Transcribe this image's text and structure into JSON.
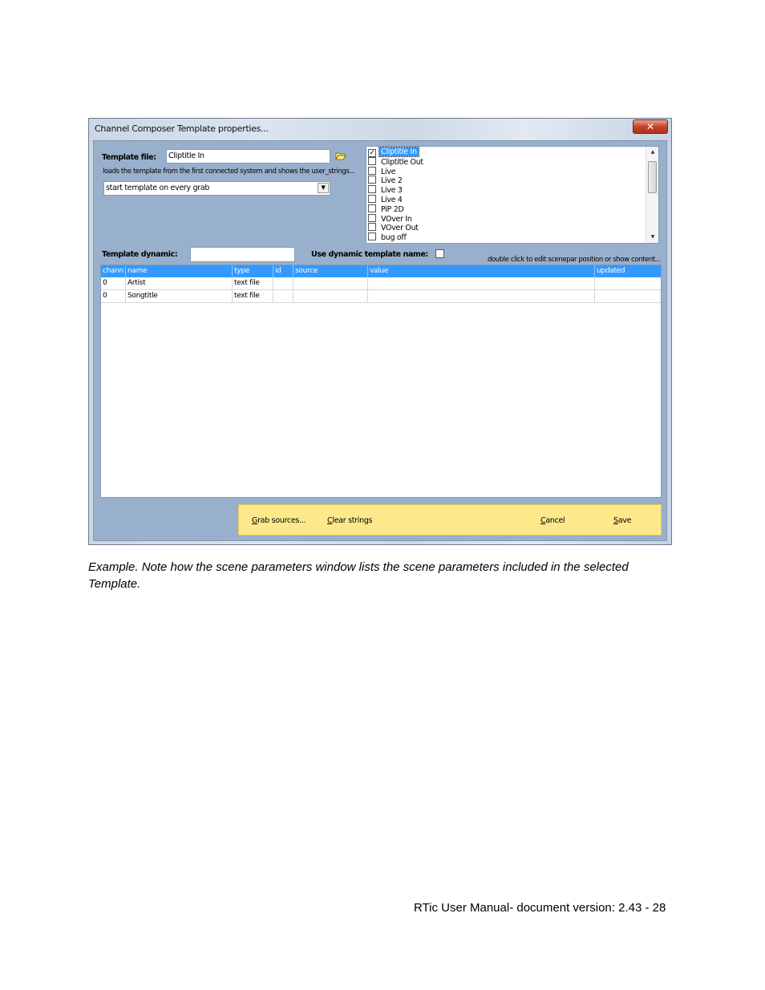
{
  "dialog": {
    "title": "Channel Composer Template properties...",
    "close_label": "✕",
    "template_file": {
      "label": "Template file:",
      "value": "Cliptitle In",
      "note": "loads the template from the first connected system and shows the user_strings...",
      "mode_selected": "start template on every grab"
    },
    "templates": [
      {
        "name": "Cliptitle In",
        "checked": true,
        "selected": true
      },
      {
        "name": "Cliptitle Out",
        "checked": false,
        "selected": false
      },
      {
        "name": "Live",
        "checked": false,
        "selected": false
      },
      {
        "name": "Live 2",
        "checked": false,
        "selected": false
      },
      {
        "name": "Live 3",
        "checked": false,
        "selected": false
      },
      {
        "name": "Live 4",
        "checked": false,
        "selected": false
      },
      {
        "name": "PiP 2D",
        "checked": false,
        "selected": false
      },
      {
        "name": "VOver In",
        "checked": false,
        "selected": false
      },
      {
        "name": "VOver Out",
        "checked": false,
        "selected": false
      },
      {
        "name": "bug off",
        "checked": false,
        "selected": false
      }
    ],
    "template_dynamic": {
      "label": "Template dynamic:",
      "value": "",
      "use_dynamic_label": "Use dynamic template name:",
      "use_dynamic_checked": false
    },
    "grid_hint": "double click to edit scenepar position or show content...",
    "grid": {
      "columns": [
        "chann",
        "name",
        "type",
        "id",
        "source",
        "value",
        "updated"
      ],
      "rows": [
        [
          "0",
          "Artist",
          "text file",
          "",
          "",
          "",
          ""
        ],
        [
          "0",
          "Songtitle",
          "text file",
          "",
          "",
          "",
          ""
        ]
      ]
    },
    "buttons": {
      "grab_first": "G",
      "grab_rest": "rab sources...",
      "clear_first": "C",
      "clear_rest": "lear strings",
      "cancel_first": "C",
      "cancel_rest": "ancel",
      "save_first": "S",
      "save_rest": "ave"
    }
  },
  "caption": "Example. Note how the scene parameters window lists the scene parameters included in the selected Template.",
  "footer": "RTic User Manual- document version: 2.43 - 28",
  "colors": {
    "client_bg": "#99b0cc",
    "grid_header": "#3399ff",
    "button_bar": "#fde98c",
    "close_button": "#c7432b"
  },
  "icons": {
    "folder": "folder-open-icon",
    "dropdown": "chevron-down-icon",
    "close": "close-icon"
  }
}
